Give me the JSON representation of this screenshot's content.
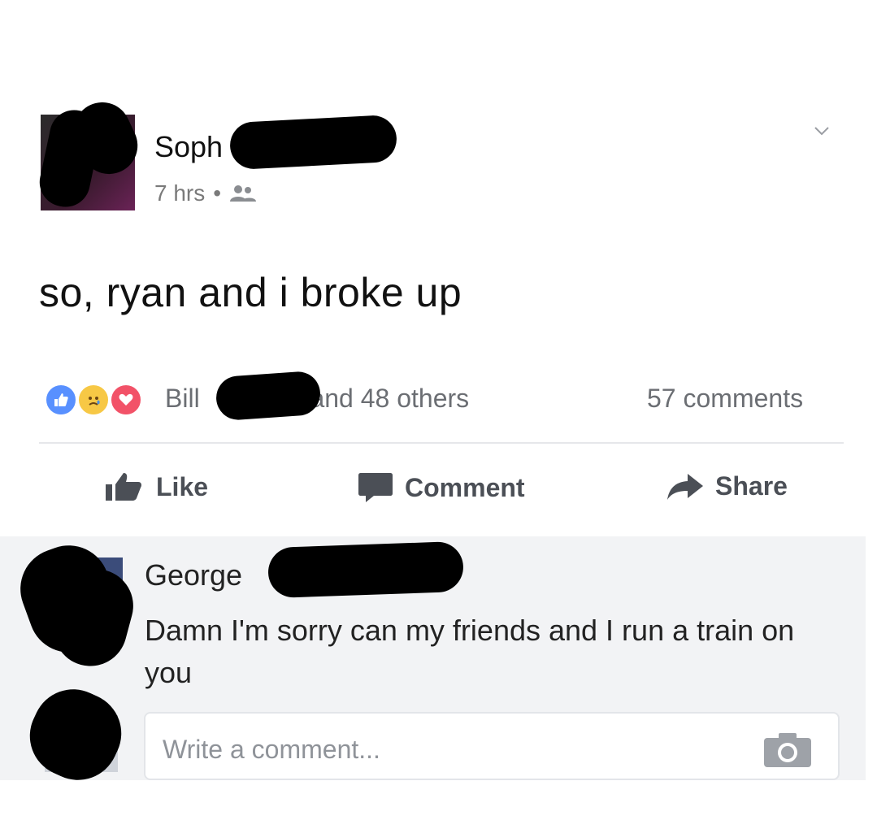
{
  "post": {
    "author_name": "Soph",
    "timestamp": "7 hrs",
    "separator": "•",
    "audience_icon": "friends-icon",
    "text": "so, ryan and i broke up",
    "menu_icon": "chevron-down-icon"
  },
  "reactions": {
    "icons": [
      "like-reaction-icon",
      "sad-reaction-icon",
      "love-reaction-icon"
    ],
    "names_prefix": "Bill",
    "names_suffix": "and 48 others",
    "comments_count": "57 comments"
  },
  "actions": {
    "like_label": "Like",
    "comment_label": "Comment",
    "share_label": "Share"
  },
  "comment": {
    "author": "George",
    "text": "Damn I'm sorry can my friends and I run a train on you"
  },
  "composer": {
    "placeholder": "Write a comment...",
    "camera_icon": "camera-icon"
  },
  "colors": {
    "reaction_like": "#5890ff",
    "reaction_sad": "#f7c845",
    "reaction_love": "#f25268",
    "action_text": "#4b4f56",
    "meta_text": "#6b6e73",
    "panel_bg": "#f2f3f5"
  }
}
